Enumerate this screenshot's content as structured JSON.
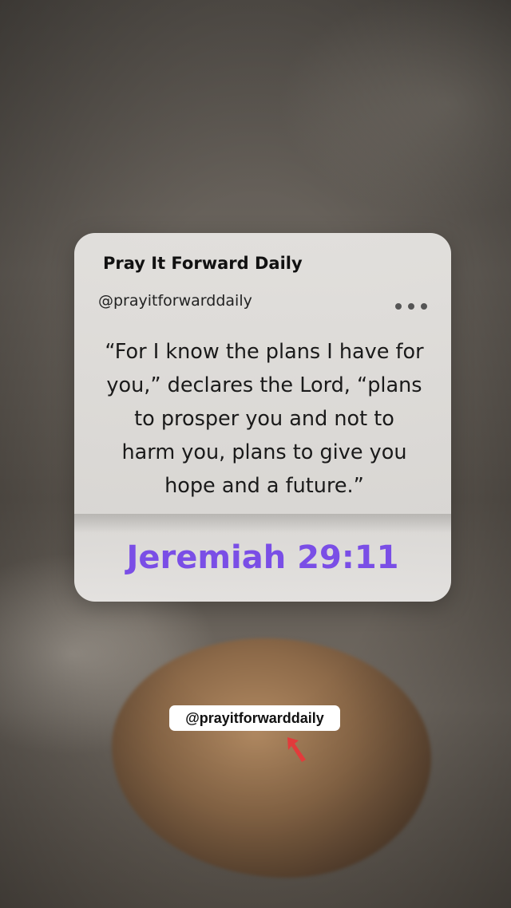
{
  "post": {
    "account_name": "Pray It Forward Daily",
    "handle": "@prayitforwarddaily",
    "more_icon": "more-horizontal-icon",
    "quote": "“For I know the plans I have for you,” declares the Lord, “plans to prosper you and not to harm you, plans to give you hope and a future.”",
    "reference": "Jeremiah 29:11"
  },
  "overlay": {
    "tag_label": "@prayitforwarddaily",
    "pointer_icon": "arrow-pointer-icon"
  },
  "colors": {
    "reference": "#7a4ee6",
    "pointer": "#e23b3b",
    "card": "#e5e3e0"
  }
}
